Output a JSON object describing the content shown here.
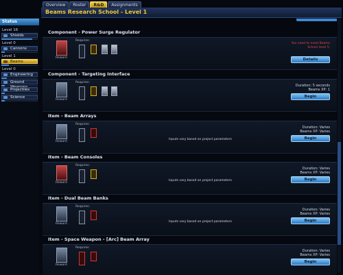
{
  "tabs": [
    "Overview",
    "Roster",
    "R&D",
    "Assignments"
  ],
  "active_tab": "R&D",
  "header": {
    "title": "Beams Research School - Level 1"
  },
  "sidebar": {
    "status_label": "Status",
    "groups": [
      {
        "level": "Level 16",
        "skills": [
          {
            "name": "Shields",
            "progress": 0.85
          }
        ]
      },
      {
        "level": "Level 0",
        "skills": [
          {
            "name": "Cannons",
            "progress": 0.1
          }
        ]
      },
      {
        "level": "Level 1",
        "skills": [
          {
            "name": "Beams",
            "progress": 0.2,
            "active": true
          }
        ]
      },
      {
        "level": "Level 0",
        "skills": [
          {
            "name": "Engineering",
            "progress": 0.15
          },
          {
            "name": "Ground Weapons",
            "progress": 0.1
          },
          {
            "name": "Projectiles",
            "progress": 0.1
          },
          {
            "name": "Science",
            "progress": 0.1
          }
        ]
      }
    ]
  },
  "labels": {
    "reward": "Reward",
    "requires": "Requires:",
    "input_note": "Inputs vary based on project parameters"
  },
  "items": [
    {
      "title": "Component - Power Surge Regulator",
      "warn": "You need to meet Beams School level 5.",
      "button": "Details"
    },
    {
      "title": "Component - Targeting Interface",
      "duration": "Duration: 5 seconds",
      "xp": "Beams XP: 1",
      "button": "Begin"
    },
    {
      "title": "Item - Beam Arrays",
      "duration": "Duration: Varies",
      "xp": "Beams XP: Varies",
      "button": "Begin"
    },
    {
      "title": "Item - Beam Consoles",
      "duration": "Duration: Varies",
      "xp": "Beams XP: Varies",
      "button": "Begin"
    },
    {
      "title": "Item - Dual Beam Banks",
      "duration": "Duration: Varies",
      "xp": "Beams XP: Varies",
      "button": "Begin"
    },
    {
      "title": "Item - Space Weapon - [Arc] Beam Array",
      "duration": "Duration: Varies",
      "xp": "Beams XP: Varies",
      "button": "Begin"
    }
  ]
}
